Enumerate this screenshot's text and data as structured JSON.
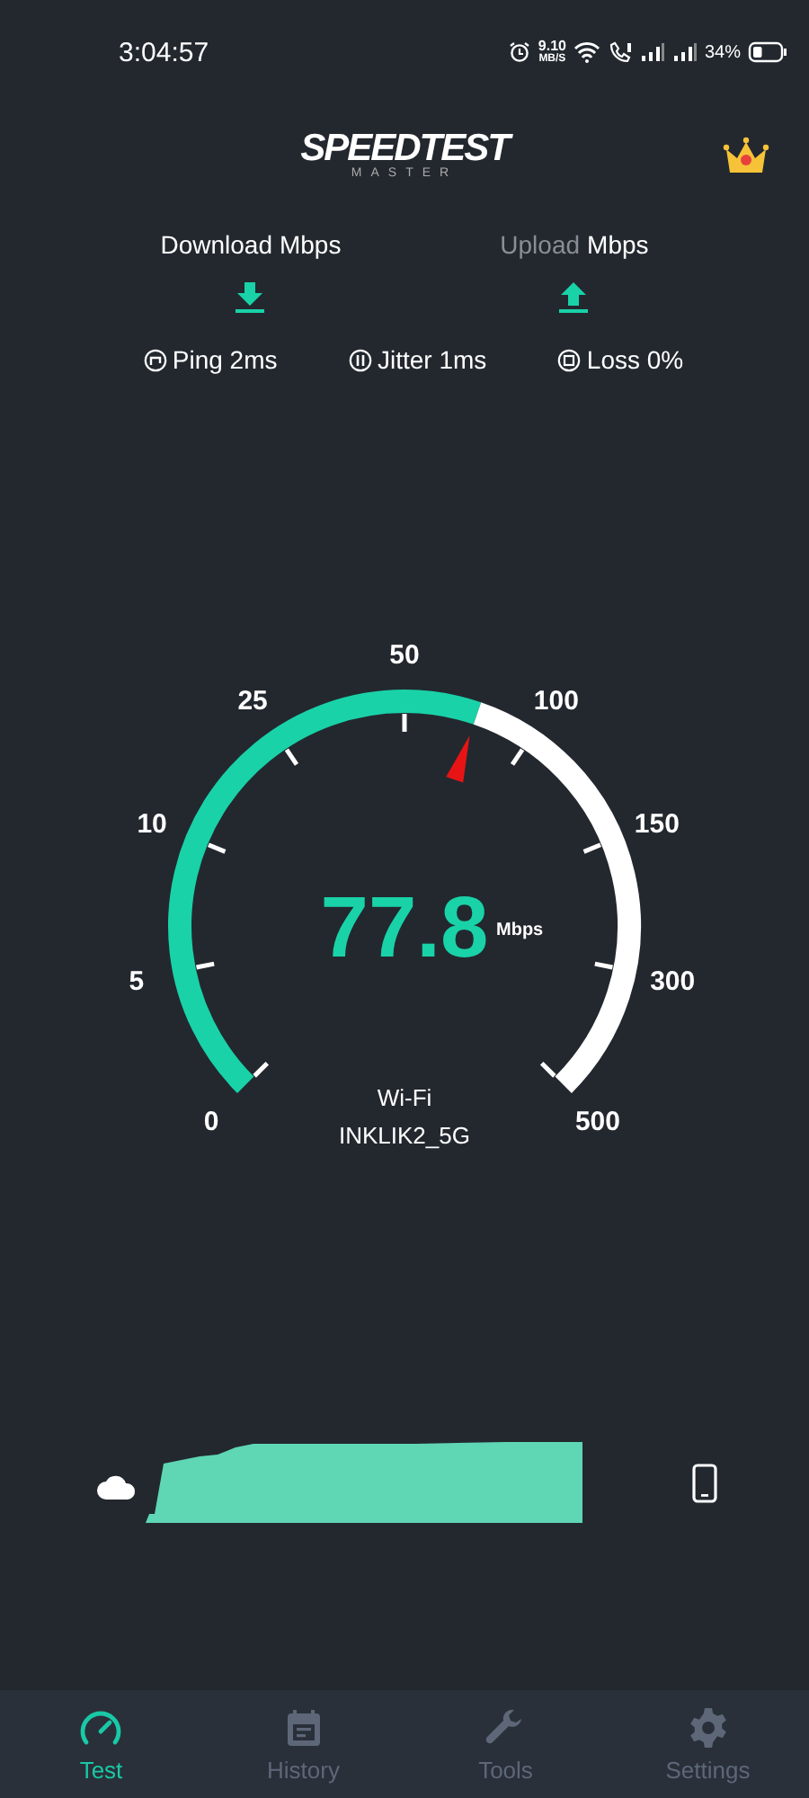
{
  "status_bar": {
    "time": "3:04:57",
    "net_speed": "9.10",
    "net_unit": "MB/S",
    "battery": "34%"
  },
  "header": {
    "logo": "SPEEDTEST",
    "logo_sub": "MASTER"
  },
  "directions": [
    {
      "kind": "download",
      "label": "Download",
      "unit": "Mbps",
      "active": true
    },
    {
      "kind": "upload",
      "label": "Upload",
      "unit": "Mbps",
      "active": false
    }
  ],
  "stats": [
    {
      "kind": "ping",
      "text": "Ping 2ms"
    },
    {
      "kind": "jitter",
      "text": "Jitter 1ms"
    },
    {
      "kind": "loss",
      "text": "Loss 0%"
    }
  ],
  "gauge": {
    "scale": [
      "0",
      "5",
      "10",
      "25",
      "50",
      "100",
      "150",
      "300",
      "500"
    ],
    "value": "77.8",
    "unit": "Mbps",
    "network": "Wi-Fi",
    "ssid": "INKLIK2_5G"
  },
  "nav": [
    {
      "kind": "test",
      "label": "Test",
      "selected": true
    },
    {
      "kind": "history",
      "label": "History",
      "selected": false
    },
    {
      "kind": "tools",
      "label": "Tools",
      "selected": false
    },
    {
      "kind": "settings",
      "label": "Settings",
      "selected": false
    }
  ]
}
